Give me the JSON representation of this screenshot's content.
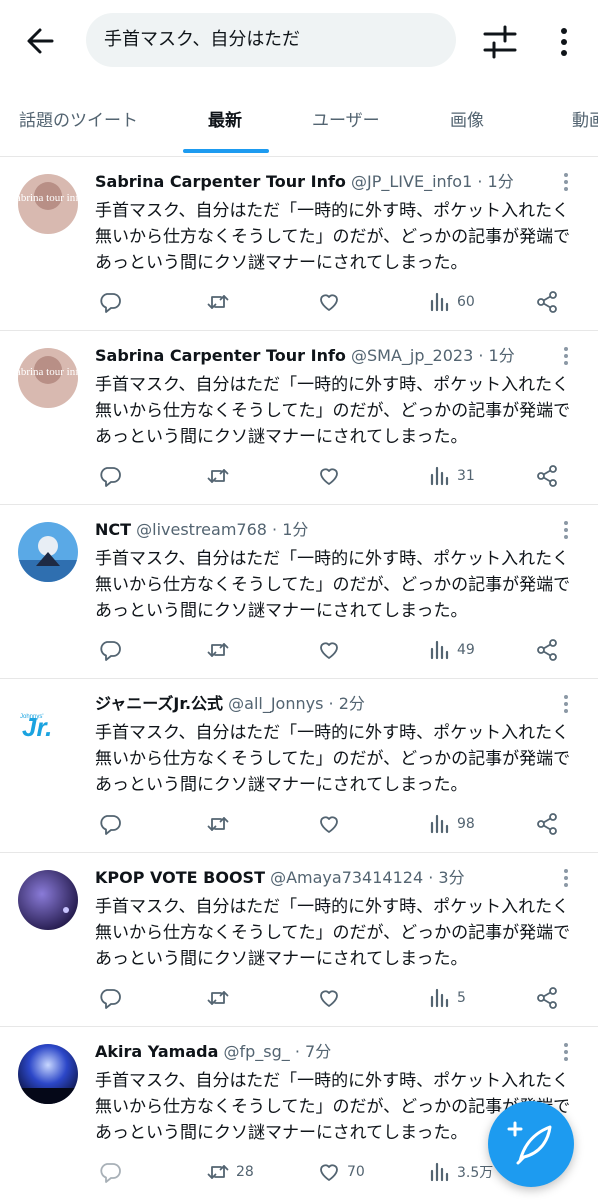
{
  "search": {
    "query": "手首マスク、自分はただ"
  },
  "tabs": [
    "話題のツイート",
    "最新",
    "ユーザー",
    "画像",
    "動画"
  ],
  "tweets": [
    {
      "name": "Sabrina Carpenter Tour Info",
      "handle": "@JP_LIVE_info1",
      "time": " · 1分",
      "text": "手首マスク、自分はただ「一時的に外す時、ポケット入れたく無いから仕方なくそうしてた」のだが、どっかの記事が発端であっという間にクソ謎マナーにされてしまった。",
      "replies": "",
      "retweets": "",
      "likes": "",
      "views": "60"
    },
    {
      "name": "Sabrina Carpenter Tour Info",
      "handle": "@SMA_jp_2023",
      "time": " · 1分",
      "text": "手首マスク、自分はただ「一時的に外す時、ポケット入れたく無いから仕方なくそうしてた」のだが、どっかの記事が発端であっという間にクソ謎マナーにされてしまった。",
      "replies": "",
      "retweets": "",
      "likes": "",
      "views": "31"
    },
    {
      "name": "NCT",
      "handle": "@livestream768",
      "time": " · 1分",
      "text": "手首マスク、自分はただ「一時的に外す時、ポケット入れたく無いから仕方なくそうしてた」のだが、どっかの記事が発端であっという間にクソ謎マナーにされてしまった。",
      "replies": "",
      "retweets": "",
      "likes": "",
      "views": "49"
    },
    {
      "name": "ジャニーズJr.公式",
      "handle": "@all_Jonnys",
      "time": " · 2分",
      "text": "手首マスク、自分はただ「一時的に外す時、ポケット入れたく無いから仕方なくそうしてた」のだが、どっかの記事が発端であっという間にクソ謎マナーにされてしまった。",
      "replies": "",
      "retweets": "",
      "likes": "",
      "views": "98"
    },
    {
      "name": "KPOP VOTE BOOST",
      "handle": "@Amaya73414124",
      "time": " · 3分",
      "text": "手首マスク、自分はただ「一時的に外す時、ポケット入れたく無いから仕方なくそうしてた」のだが、どっかの記事が発端であっという間にクソ謎マナーにされてしまった。",
      "replies": "",
      "retweets": "",
      "likes": "",
      "views": "5"
    },
    {
      "name": "Akira Yamada",
      "handle": "@fp_sg_",
      "time": " · 7分",
      "text": "手首マスク、自分はただ「一時的に外す時、ポケット入れたく無いから仕方なくそうしてた」のだが、どっかの記事が発端であっという間にクソ謎マナーにされてしまった。",
      "replies": "",
      "retweets": "28",
      "likes": "70",
      "views": "3.5万"
    }
  ],
  "avatars": [
    "sabrina-avatar",
    "sabrina-avatar",
    "nct-avatar",
    "jr-logo-avatar",
    "kpop-avatar",
    "concert-avatar"
  ],
  "avatar_text": {
    "sabrina": "sabrina tour info",
    "jr": "Jr.",
    "jr_small": "Johnnys'"
  },
  "colors": {
    "accent": "#1d9bf0",
    "text": "#0f1419",
    "muted": "#536471"
  }
}
